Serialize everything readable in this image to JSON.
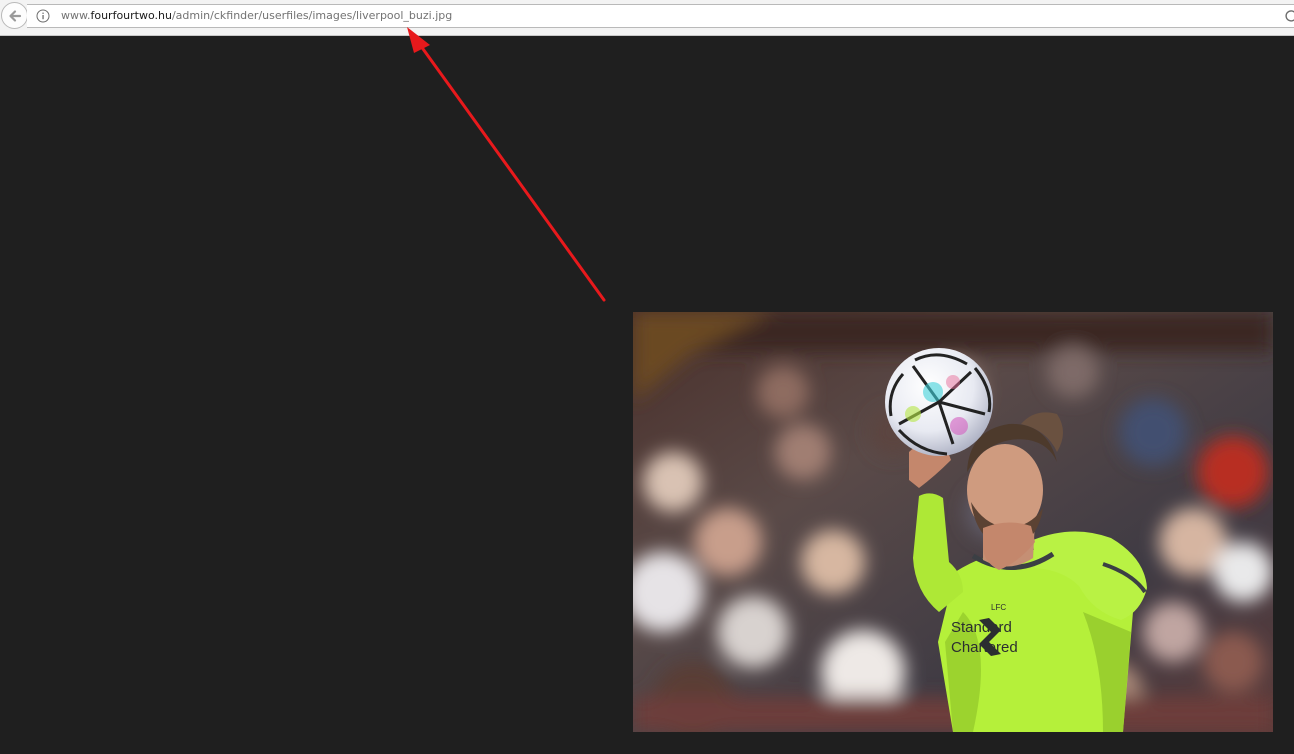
{
  "browser": {
    "url_prefix": "www.",
    "url_host": "fourfourtwo.hu",
    "url_path": "/admin/ckfinder/userfiles/images/liverpool_buzi.jpg",
    "back_icon": "back-arrow-icon",
    "info_icon": "info-icon",
    "reload_icon": "reload-icon"
  },
  "annotation": {
    "color": "#e8191c"
  },
  "image": {
    "subject": "football-player-holding-ball",
    "kit_text_line1": "Standard",
    "kit_text_line2": "Chartered",
    "crest_text": "LFC",
    "kit_color": "#b5f03a"
  }
}
